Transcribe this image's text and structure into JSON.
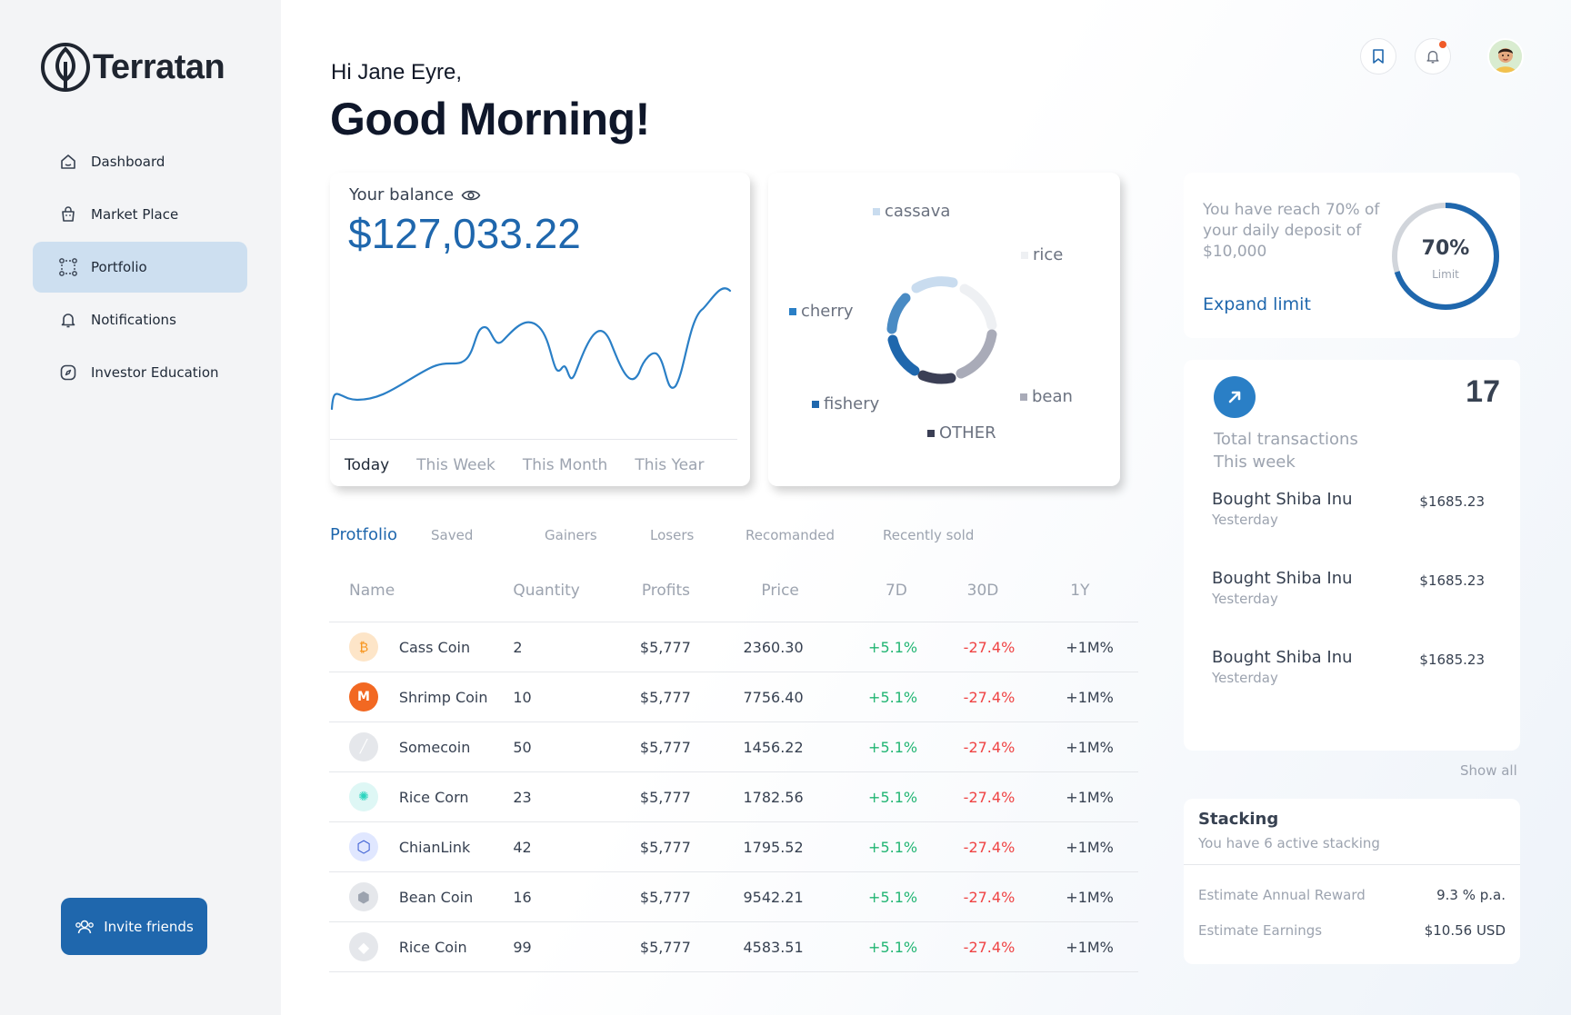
{
  "brand": {
    "name": "Terratan"
  },
  "sidebar": {
    "items": [
      {
        "label": "Dashboard",
        "icon": "home-icon"
      },
      {
        "label": "Market Place",
        "icon": "bag-icon"
      },
      {
        "label": "Portfolio",
        "icon": "portfolio-icon",
        "active": true
      },
      {
        "label": "Notifications",
        "icon": "bell-icon"
      },
      {
        "label": "Investor Education",
        "icon": "compass-icon"
      }
    ],
    "invite_label": "Invite friends"
  },
  "header": {
    "greeting": "Hi Jane Eyre,",
    "headline": "Good Morning!"
  },
  "balance": {
    "label": "Your balance",
    "value": "$127,033.22",
    "periods": [
      "Today",
      "This Week",
      "This Month",
      "This Year"
    ],
    "active_period": "Today"
  },
  "donut": {
    "legend": [
      {
        "label": "cassava",
        "color": "#c9dcef"
      },
      {
        "label": "rice",
        "color": "#eef0f3"
      },
      {
        "label": "cherry",
        "color": "#2a7fc6"
      },
      {
        "label": "bean",
        "color": "#a9abb8"
      },
      {
        "label": "fishery",
        "color": "#1f67ad"
      },
      {
        "label": "OTHER",
        "color": "#3b3f55"
      }
    ]
  },
  "tabs": [
    "Protfolio",
    "Saved",
    "Gainers",
    "Losers",
    "Recomanded",
    "Recently sold"
  ],
  "table": {
    "headers": [
      "Name",
      "Quantity",
      "Profits",
      "Price",
      "7D",
      "30D",
      "1Y"
    ],
    "rows": [
      {
        "name": "Cass Coin",
        "qty": "2",
        "profit": "$5,777",
        "price": "2360.30",
        "d7": "+5.1%",
        "d30": "-27.4%",
        "y1": "+1M%"
      },
      {
        "name": "Shrimp Coin",
        "qty": "10",
        "profit": "$5,777",
        "price": "7756.40",
        "d7": "+5.1%",
        "d30": "-27.4%",
        "y1": "+1M%"
      },
      {
        "name": "Somecoin",
        "qty": "50",
        "profit": "$5,777",
        "price": "1456.22",
        "d7": "+5.1%",
        "d30": "-27.4%",
        "y1": "+1M%"
      },
      {
        "name": "Rice Corn",
        "qty": "23",
        "profit": "$5,777",
        "price": "1782.56",
        "d7": "+5.1%",
        "d30": "-27.4%",
        "y1": "+1M%"
      },
      {
        "name": "ChianLink",
        "qty": "42",
        "profit": "$5,777",
        "price": "1795.52",
        "d7": "+5.1%",
        "d30": "-27.4%",
        "y1": "+1M%"
      },
      {
        "name": "Bean Coin",
        "qty": "16",
        "profit": "$5,777",
        "price": "9542.21",
        "d7": "+5.1%",
        "d30": "-27.4%",
        "y1": "+1M%"
      },
      {
        "name": "Rice Coin",
        "qty": "99",
        "profit": "$5,777",
        "price": "4583.51",
        "d7": "+5.1%",
        "d30": "-27.4%",
        "y1": "+1M%"
      }
    ]
  },
  "limit": {
    "text": "You have reach 70% of your daily deposit of $10,000",
    "percent_label": "70%",
    "percent": 0.7,
    "caption": "Limit",
    "expand_label": "Expand limit"
  },
  "transactions": {
    "count": "17",
    "title_line1": "Total transactions",
    "title_line2": "This week",
    "items": [
      {
        "title": "Bought Shiba Inu",
        "when": "Yesterday",
        "amount": "$1685.23"
      },
      {
        "title": "Bought Shiba Inu",
        "when": "Yesterday",
        "amount": "$1685.23"
      },
      {
        "title": "Bought Shiba Inu",
        "when": "Yesterday",
        "amount": "$1685.23"
      }
    ],
    "show_all": "Show all"
  },
  "stacking": {
    "title": "Stacking",
    "subtitle": "You have 6 active stacking",
    "rows": [
      {
        "label": "Estimate Annual Reward",
        "value": "9.3 % p.a."
      },
      {
        "label": "Estimate Earnings",
        "value": "$10.56 USD"
      }
    ]
  },
  "colors": {
    "accent": "#1f67ad",
    "positive": "#22b573",
    "negative": "#ef4444"
  }
}
